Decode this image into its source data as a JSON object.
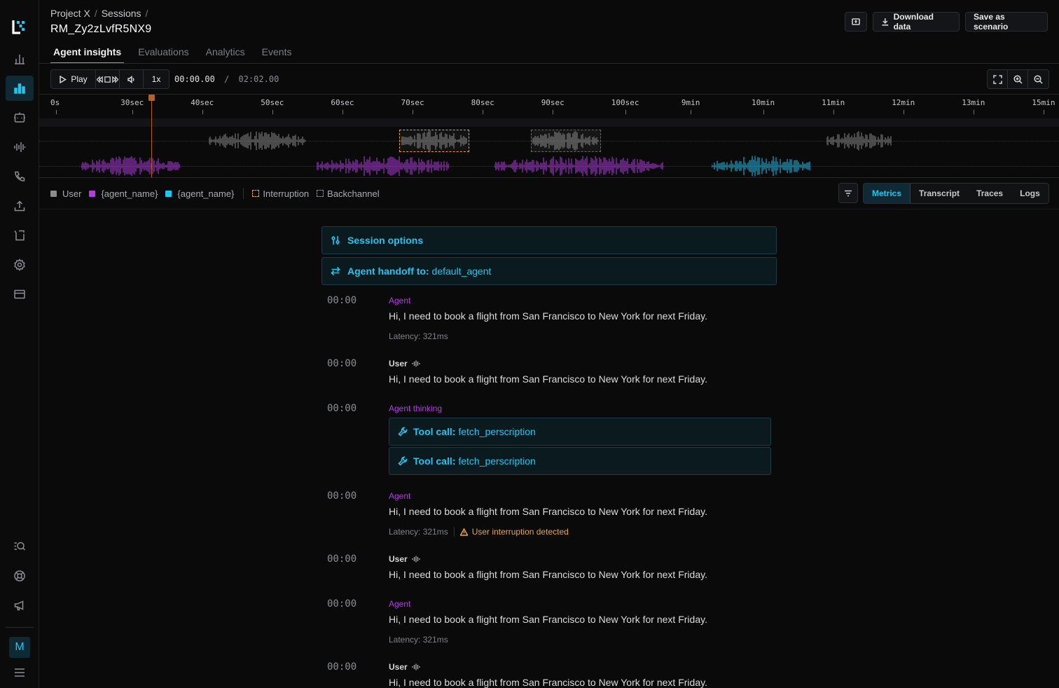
{
  "breadcrumb": {
    "project": "Project X",
    "sessions": "Sessions"
  },
  "page_title": "RM_Zy2zLvfR5NX9",
  "header_buttons": {
    "download": "Download data",
    "save": "Save as scenario"
  },
  "tabs": [
    {
      "label": "Agent insights",
      "active": true
    },
    {
      "label": "Evaluations",
      "active": false
    },
    {
      "label": "Analytics",
      "active": false
    },
    {
      "label": "Events",
      "active": false
    }
  ],
  "player": {
    "play_label": "Play",
    "speed": "1x",
    "current_time": "00:00.00",
    "separator": "/",
    "duration": "02:02.00"
  },
  "timeline": {
    "ticks": [
      "0s",
      "30sec",
      "40sec",
      "50sec",
      "60sec",
      "70sec",
      "80sec",
      "90sec",
      "100sec",
      "9min",
      "10min",
      "11min",
      "12min",
      "13min",
      "15min"
    ]
  },
  "legend": {
    "user": "User",
    "agent_a": "{agent_name}",
    "agent_b": "{agent_name}",
    "interruption": "Interruption",
    "backchannel": "Backchannel"
  },
  "view_tabs": [
    {
      "label": "Metrics",
      "active": true
    },
    {
      "label": "Transcript",
      "active": false
    },
    {
      "label": "Traces",
      "active": false
    },
    {
      "label": "Logs",
      "active": false
    }
  ],
  "session_options": "Session options",
  "handoff": {
    "label": "Agent handoff to:",
    "value": "default_agent"
  },
  "feed": [
    {
      "time": "00:00",
      "role": "Agent",
      "kind": "agent",
      "text": "Hi, I need to book a flight from San Francisco to New York for next Friday.",
      "latency": "Latency: 321ms"
    },
    {
      "time": "00:00",
      "role": "User",
      "kind": "user",
      "text": "Hi, I need to book a flight from San Francisco to New York for next Friday."
    },
    {
      "time": "00:00",
      "role": "Agent thinking",
      "kind": "agent"
    },
    {
      "time": "00:00",
      "role": "Agent",
      "kind": "agent",
      "text": "Hi, I need to book a flight from San Francisco to New York for next Friday.",
      "latency": "Latency: 321ms",
      "warning": "User interruption detected"
    },
    {
      "time": "00:00",
      "role": "User",
      "kind": "user",
      "text": "Hi, I need to book a flight from San Francisco to New York for next Friday."
    },
    {
      "time": "00:00",
      "role": "Agent",
      "kind": "agent",
      "text": "Hi, I need to book a flight from San Francisco to New York for next Friday.",
      "latency": "Latency: 321ms"
    },
    {
      "time": "00:00",
      "role": "User",
      "kind": "user",
      "text": "Hi, I need to book a flight from San Francisco to New York for next Friday."
    }
  ],
  "tool_calls": [
    {
      "label": "Tool call:",
      "value": "fetch_perscription"
    },
    {
      "label": "Tool call:",
      "value": "fetch_perscription"
    }
  ],
  "avatar_initial": "M",
  "colors": {
    "accent": "#22c4f0",
    "agent_purple": "#b13ce0",
    "user_grey": "#8c8c8c",
    "warning": "#e6a44a",
    "playhead": "#b0622a"
  },
  "icons": {
    "sidebar": [
      "chart-icon",
      "bar-chart-icon",
      "bot-icon",
      "waveform-icon",
      "phone-icon",
      "upload-icon",
      "scenario-icon",
      "settings-icon",
      "card-icon",
      "search-list-icon",
      "lifebuoy-icon",
      "megaphone-icon",
      "menu-icon"
    ]
  }
}
